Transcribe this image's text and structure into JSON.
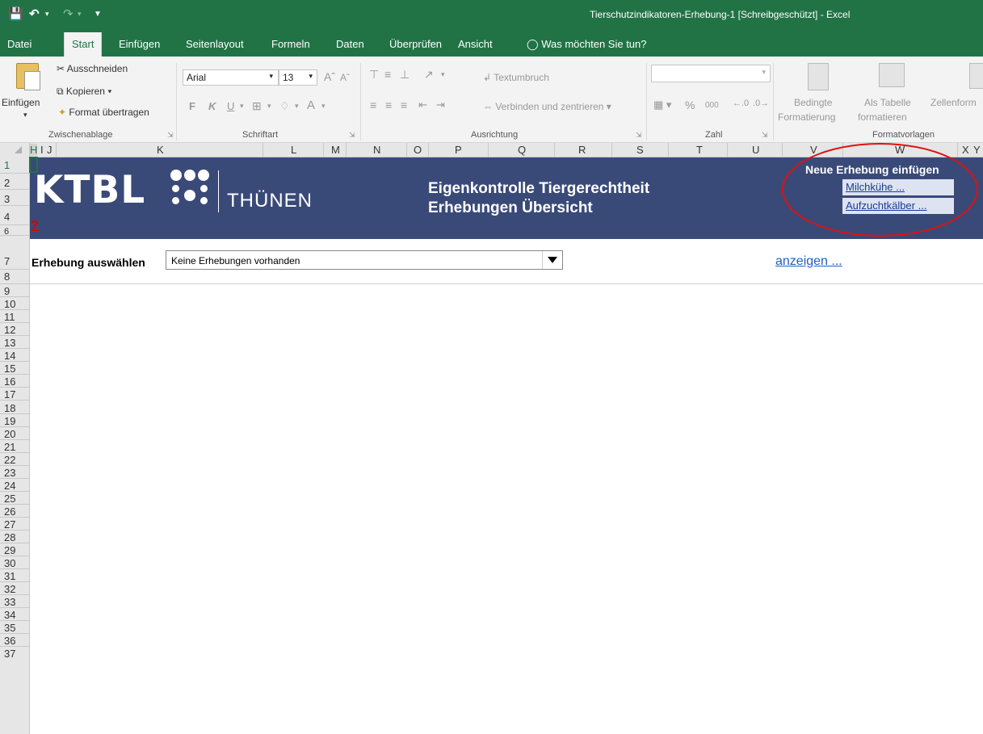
{
  "window": {
    "title": "Tierschutzindikatoren-Erhebung-1  [Schreibgeschützt] - Excel"
  },
  "tabs": [
    "Datei",
    "Start",
    "Einfügen",
    "Seitenlayout",
    "Formeln",
    "Daten",
    "Überprüfen",
    "Ansicht"
  ],
  "tell_me": "Was möchten Sie tun?",
  "ribbon": {
    "clipboard": {
      "paste": "Einfügen",
      "cut": "Ausschneiden",
      "copy": "Kopieren",
      "format_painter": "Format übertragen",
      "group": "Zwischenablage"
    },
    "font": {
      "name": "Arial",
      "size": "13",
      "bold": "F",
      "italic": "K",
      "underline": "U",
      "group": "Schriftart"
    },
    "alignment": {
      "wrap": "Textumbruch",
      "merge": "Verbinden und zentrieren",
      "group": "Ausrichtung"
    },
    "number": {
      "percent": "%",
      "thousands": "000",
      "group": "Zahl"
    },
    "styles": {
      "conditional_1": "Bedingte",
      "conditional_2": "Formatierung",
      "astable_1": "Als Tabelle",
      "astable_2": "formatieren",
      "cell_styles": "Zellenform",
      "group": "Formatvorlagen"
    }
  },
  "columns": [
    "H",
    "I",
    "J",
    "K",
    "L",
    "M",
    "N",
    "O",
    "P",
    "Q",
    "R",
    "S",
    "T",
    "U",
    "V",
    "W",
    "X",
    "Y"
  ],
  "rows": [
    "1",
    "2",
    "3",
    "4",
    "6",
    "7",
    "8",
    "9",
    "10",
    "11",
    "12",
    "13",
    "14",
    "15",
    "16",
    "17",
    "18",
    "19",
    "20",
    "21",
    "22",
    "23",
    "24",
    "25",
    "26",
    "27",
    "28",
    "29",
    "30",
    "31",
    "32",
    "33",
    "34",
    "35",
    "36",
    "37"
  ],
  "banner": {
    "logo_ktbl": "KTBL",
    "logo_thunen": "THÜNEN",
    "title_line1": "Eigenkontrolle Tiergerechtheit",
    "title_line2": "Erhebungen Übersicht",
    "help": "?",
    "new_survey_header": "Neue Erhebung einfügen",
    "link_dairy": "Milchkühe ...",
    "link_calves": "Aufzuchtkälber ..."
  },
  "selection": {
    "label": "Erhebung auswählen",
    "dropdown_value": "Keine Erhebungen vorhanden",
    "show_link": "anzeigen ..."
  },
  "colors": {
    "excel_green": "#217346",
    "banner": "#3a4a78",
    "annotation": "#e01010"
  }
}
